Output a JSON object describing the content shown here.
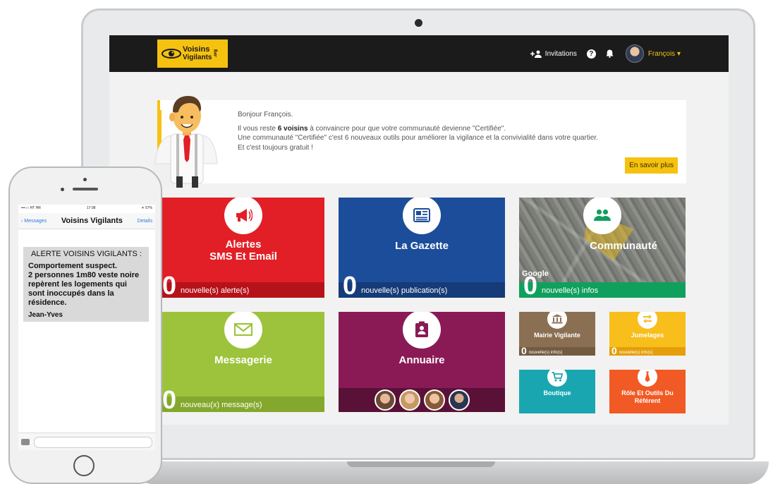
{
  "topbar": {
    "logo_line1": "Voisins",
    "logo_line2": "Vigilants",
    "logo_suffix": ".org",
    "invitations": "Invitations",
    "help_icon": "?",
    "user_name": "François",
    "user_caret": "▾"
  },
  "welcome": {
    "greeting": "Bonjour François.",
    "line2_pre": "Il vous reste ",
    "line2_bold": "6 voisins",
    "line2_post": " à convaincre pour que votre communauté devienne \"Certifiée\".",
    "line3": "Une communauté \"Certifiée\" c'est 6 nouveaux outils pour améliorer la vigilance et la convivialité dans votre quartier.",
    "line4": "Et c'est toujours gratuit !",
    "button": "En savoir plus"
  },
  "tiles": {
    "alertes": {
      "title1": "Alertes",
      "title2": "SMS Et Email",
      "count": "0",
      "label": "nouvelle(s) alerte(s)",
      "icon": "megaphone-icon"
    },
    "gazette": {
      "title": "La Gazette",
      "count": "0",
      "label": "nouvelle(s) publication(s)",
      "icon": "newspaper-icon"
    },
    "communaute": {
      "title": "Communauté",
      "count": "0",
      "label": "nouvelle(s) infos",
      "map_label": "Google",
      "icon": "people-icon"
    },
    "messagerie": {
      "title": "Messagerie",
      "count": "0",
      "label": "nouveau(x) message(s)",
      "icon": "envelope-icon"
    },
    "annuaire": {
      "title": "Annuaire",
      "icon": "contact-card-icon"
    },
    "mairie": {
      "title": "Mairie Vigilante",
      "count": "0",
      "label": "nouvelle(s) info(s)",
      "icon": "townhall-icon"
    },
    "jumelages": {
      "title": "Jumelages",
      "count": "0",
      "label": "nouvelle(s) info(s)",
      "icon": "exchange-icon"
    },
    "boutique": {
      "title": "Boutique",
      "icon": "cart-icon"
    },
    "referent": {
      "title1": "Rôle Et Outils Du",
      "title2": "Référent",
      "icon": "tie-icon"
    }
  },
  "colors": {
    "yellow": "#f5c210",
    "red": "#e21f26",
    "blue": "#1b4d9a",
    "green": "#10a05d",
    "lime": "#9cc33b",
    "plum": "#8a1a55",
    "brown": "#8a6f52",
    "amber": "#f7be1c",
    "teal": "#1aa6b0",
    "orange": "#f15a24"
  },
  "phone": {
    "status_left": "•••○○ HT HR ",
    "status_time": "17:08",
    "status_right": "✈ 57%",
    "back_label": "‹ Messages",
    "title": "Voisins Vigilants",
    "details": "Details",
    "alert_title": "ALERTE VOISINS VIGILANTS :",
    "body_line1": "Comportement suspect.",
    "body_line2": "2 personnes 1m80 veste noire repèrent les logements qui sont inoccupés dans la résidence.",
    "signature": "Jean-Yves"
  }
}
